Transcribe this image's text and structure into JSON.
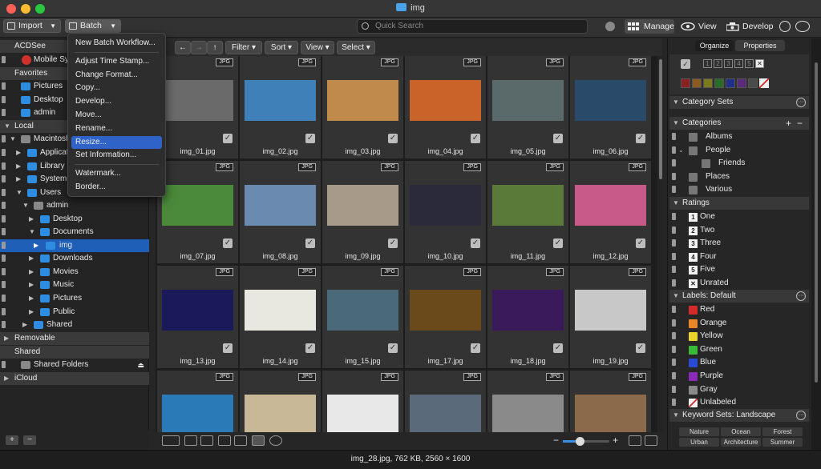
{
  "window": {
    "title": "img"
  },
  "toolbar": {
    "import_label": "Import",
    "batch_label": "Batch",
    "search_placeholder": "Quick Search",
    "modes": [
      "Manage",
      "View",
      "Develop"
    ]
  },
  "batch_menu": {
    "items": [
      "New Batch Workflow...",
      "Adjust Time Stamp...",
      "Change Format...",
      "Copy...",
      "Develop...",
      "Move...",
      "Rename...",
      "Resize...",
      "Set Information...",
      "Watermark...",
      "Border..."
    ],
    "highlighted": "Resize..."
  },
  "sidebar": {
    "acdsee": "ACDSee",
    "mobile_sync": "Mobile Sync",
    "favorites": "Favorites",
    "fav_items": [
      "Pictures",
      "Desktop",
      "admin"
    ],
    "local": "Local",
    "macintosh": "Macintosh HD",
    "applications": "Applications",
    "library": "Library",
    "system": "System",
    "users": "Users",
    "admin": "admin",
    "desktop": "Desktop",
    "documents": "Documents",
    "img": "img",
    "downloads": "Downloads",
    "movies": "Movies",
    "music": "Music",
    "pictures": "Pictures",
    "public": "Public",
    "shared": "Shared",
    "removable": "Removable",
    "shared_section": "Shared",
    "shared_folders": "Shared Folders",
    "icloud": "iCloud"
  },
  "browse_toolbar": {
    "filter": "Filter",
    "sort": "Sort",
    "view": "View",
    "select": "Select"
  },
  "thumbnails": [
    {
      "name": "img_01.jpg",
      "badge": "JPG"
    },
    {
      "name": "img_02.jpg",
      "badge": "JPG"
    },
    {
      "name": "img_03.jpg",
      "badge": "JPG"
    },
    {
      "name": "img_04.jpg",
      "badge": "JPG"
    },
    {
      "name": "img_05.jpg",
      "badge": "JPG"
    },
    {
      "name": "img_06.jpg",
      "badge": "JPG"
    },
    {
      "name": "img_07.jpg",
      "badge": "JPG"
    },
    {
      "name": "img_08.jpg",
      "badge": "JPG"
    },
    {
      "name": "img_09.jpg",
      "badge": "JPG"
    },
    {
      "name": "img_10.jpg",
      "badge": "JPG"
    },
    {
      "name": "img_11.jpg",
      "badge": "JPG"
    },
    {
      "name": "img_12.jpg",
      "badge": "JPG"
    },
    {
      "name": "img_13.jpg",
      "badge": "JPG"
    },
    {
      "name": "img_14.jpg",
      "badge": "JPG"
    },
    {
      "name": "img_15.jpg",
      "badge": "JPG"
    },
    {
      "name": "img_17.jpg",
      "badge": "JPG"
    },
    {
      "name": "img_18.jpg",
      "badge": "JPG"
    },
    {
      "name": "img_19.jpg",
      "badge": "JPG"
    },
    {
      "name": "",
      "badge": "JPG"
    },
    {
      "name": "",
      "badge": "JPG"
    },
    {
      "name": "",
      "badge": "JPG"
    },
    {
      "name": "",
      "badge": "JPG"
    },
    {
      "name": "",
      "badge": "JPG"
    },
    {
      "name": "",
      "badge": "JPG"
    }
  ],
  "thumb_colors": [
    "#6a6a6a",
    "#3f80b8",
    "#c08a4a",
    "#c9632a",
    "#5a6a6a",
    "#2a4a6a",
    "#4a8a3a",
    "#6a8ab0",
    "#a89a88",
    "#2a2a3a",
    "#5a7a3a",
    "#c85a8a",
    "#1a1a5a",
    "#e8e8e0",
    "#4a6a7a",
    "#6a4a1a",
    "#3a1a5a",
    "#c8c8c8",
    "#2a7ab8",
    "#c8b898",
    "#e8e8e8",
    "#5a6a7a",
    "#8a8a8a",
    "#8a6a4a"
  ],
  "status_bar": {
    "text": "img_28.jpg, 762 KB, 2560 × 1600"
  },
  "right_panel": {
    "tabs": [
      "Organize",
      "Properties"
    ],
    "rating_boxes": [
      "1",
      "2",
      "3",
      "4",
      "5",
      "✕"
    ],
    "color_swatches": [
      "#8a2020",
      "#8a5a20",
      "#7a7a20",
      "#2a6a2a",
      "#22308a",
      "#5a2a7a",
      "#4a4a4a"
    ],
    "category_sets": "Category Sets",
    "categories": "Categories",
    "category_items": [
      "Albums",
      "People",
      "Friends",
      "Places",
      "Various"
    ],
    "ratings": "Ratings",
    "rating_items": [
      {
        "num": "1",
        "label": "One"
      },
      {
        "num": "2",
        "label": "Two"
      },
      {
        "num": "3",
        "label": "Three"
      },
      {
        "num": "4",
        "label": "Four"
      },
      {
        "num": "5",
        "label": "Five"
      },
      {
        "num": "✕",
        "label": "Unrated"
      }
    ],
    "labels_header": "Labels: Default",
    "label_items": [
      {
        "label": "Red",
        "color": "#d42a2a"
      },
      {
        "label": "Orange",
        "color": "#e8862a"
      },
      {
        "label": "Yellow",
        "color": "#e8d42a"
      },
      {
        "label": "Green",
        "color": "#3ab83a"
      },
      {
        "label": "Blue",
        "color": "#2a4ad4"
      },
      {
        "label": "Purple",
        "color": "#8a2ab8"
      },
      {
        "label": "Gray",
        "color": "#8a8a8a"
      },
      {
        "label": "Unlabeled",
        "color": "#f2f2f2"
      }
    ],
    "keyword_sets": "Keyword Sets: Landscape",
    "keywords": [
      "Nature",
      "Ocean",
      "Forest",
      "Urban",
      "Architecture",
      "Summer"
    ]
  }
}
